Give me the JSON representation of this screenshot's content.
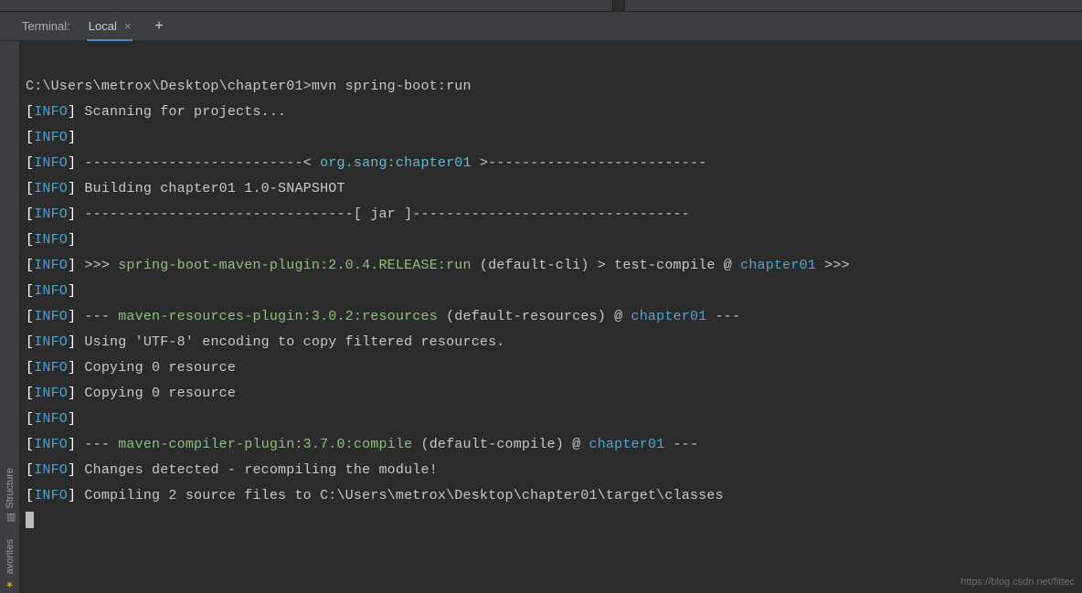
{
  "tabbar": {
    "title": "Terminal:",
    "tabs": [
      {
        "label": "Local",
        "closable": true,
        "active": true
      }
    ],
    "plus": "+"
  },
  "side": {
    "structure": "Structure",
    "favorites": "avorites"
  },
  "term": {
    "prompt_path": "C:\\Users\\metrox\\Desktop\\chapter01>",
    "cmd": "mvn spring-boot:run",
    "lines": {
      "level": "INFO",
      "scan": "Scanning for projects...",
      "proj_sep_l": "--------------------------< ",
      "proj_artifact": "org.sang:chapter01",
      "proj_sep_r": " >--------------------------",
      "building": "Building chapter01 1.0-SNAPSHOT",
      "jar_sep_l": "--------------------------------[ ",
      "jar": "jar",
      "jar_sep_r": " ]---------------------------------",
      "run_plugin": "spring-boot-maven-plugin:2.0.4.RELEASE:run",
      "run_goal": "(default-cli) > test-compile @ ",
      "run_mod": "chapter01",
      "run_tail": " >>>",
      "res_plugin": "maven-resources-plugin:3.0.2:resources",
      "res_goal": "(default-resources) @ ",
      "res_mod": "chapter01",
      "res_dash": " ---",
      "utf8": "Using 'UTF-8' encoding to copy filtered resources.",
      "copy0a": "Copying 0 resource",
      "copy0b": "Copying 0 resource",
      "comp_plugin": "maven-compiler-plugin:3.7.0:compile",
      "comp_goal": "(default-compile) @ ",
      "comp_mod": "chapter01",
      "comp_dash": " ---",
      "changes": "Changes detected - recompiling the module!",
      "compiling": "Compiling 2 source files to C:\\Users\\metrox\\Desktop\\chapter01\\target\\classes"
    }
  },
  "watermark": "https://blog.csdn.net/fittec"
}
